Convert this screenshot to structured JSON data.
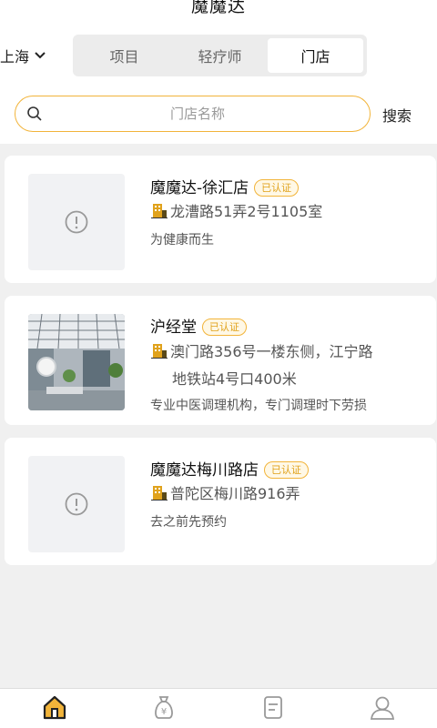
{
  "header": {
    "title": "魔魔达"
  },
  "city": {
    "label": "上海"
  },
  "segments": [
    {
      "label": "项目",
      "active": false
    },
    {
      "label": "轻疗师",
      "active": false
    },
    {
      "label": "门店",
      "active": true
    }
  ],
  "search": {
    "placeholder": "门店名称",
    "value": "",
    "button": "搜索"
  },
  "stores": [
    {
      "name": "魔魔达-徐汇店",
      "badge": "已认证",
      "address": "龙漕路51弄2号1105室",
      "address_line2": "",
      "desc": "为健康而生",
      "image": "placeholder"
    },
    {
      "name": "沪经堂",
      "badge": "已认证",
      "address": "澳门路356号一楼东侧，江宁路",
      "address_line2": "地铁站4号口400米",
      "desc": "专业中医调理机构，专门调理时下劳损",
      "image": "photo"
    },
    {
      "name": "魔魔达梅川路店",
      "badge": "已认证",
      "address": "普陀区梅川路916弄",
      "address_line2": "",
      "desc": "去之前先预约",
      "image": "placeholder"
    }
  ],
  "tabbar": [
    {
      "icon": "home-icon",
      "active": true
    },
    {
      "icon": "money-bag-icon",
      "active": false
    },
    {
      "icon": "document-icon",
      "active": false
    },
    {
      "icon": "user-icon",
      "active": false
    }
  ],
  "colors": {
    "accent": "#f2b43a",
    "badge_text": "#e0a21c",
    "background": "#f0f0f0"
  }
}
